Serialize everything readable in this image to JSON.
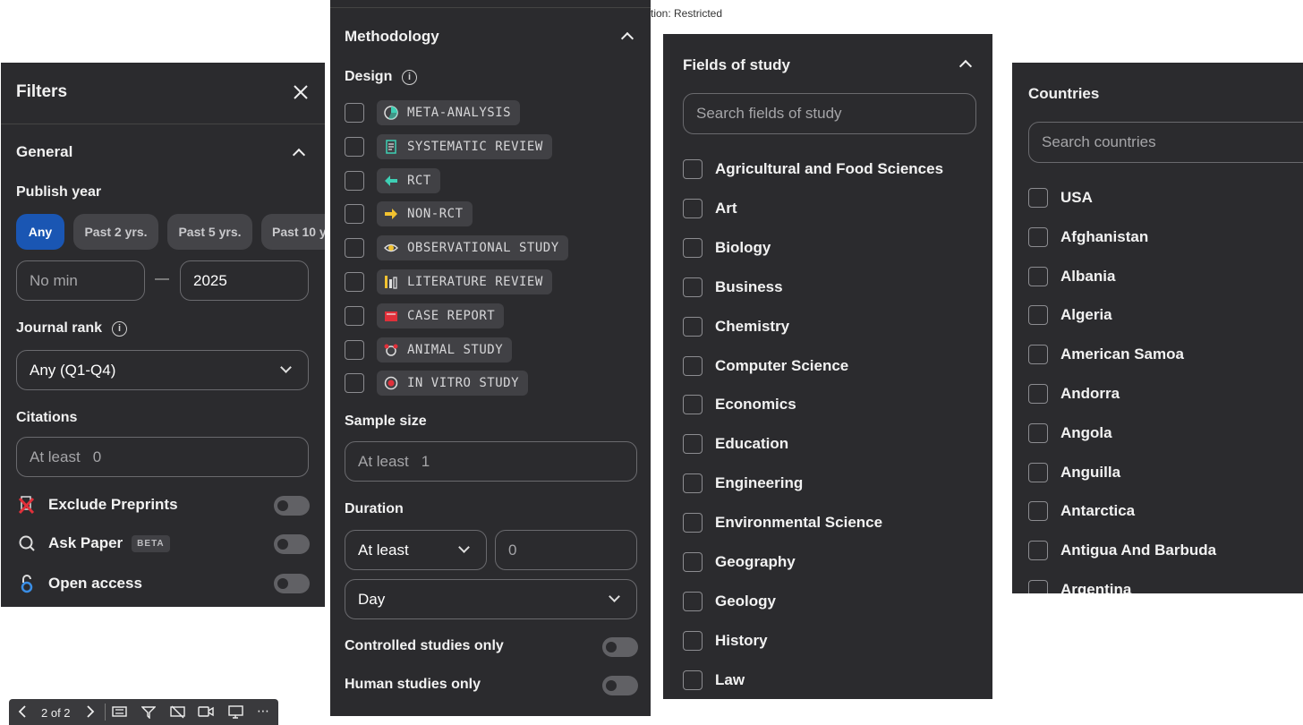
{
  "top_caption": "tion: Restricted",
  "filters": {
    "title": "Filters",
    "general": {
      "heading": "General",
      "publish_year_label": "Publish year",
      "year_options": [
        "Any",
        "Past 2 yrs.",
        "Past 5 yrs.",
        "Past 10 y"
      ],
      "min_placeholder": "No min",
      "dash": "—",
      "max_value": "2025",
      "journal_rank_label": "Journal rank",
      "journal_rank_value": "Any (Q1-Q4)",
      "citations_label": "Citations",
      "citations_prefix": "At least",
      "citations_value": "0",
      "toggles": [
        {
          "label": "Exclude Preprints",
          "icon": "preprint-icon"
        },
        {
          "label": "Ask Paper",
          "badge": "BETA",
          "icon": "ask-paper-icon"
        },
        {
          "label": "Open access",
          "icon": "open-lock-icon"
        }
      ]
    }
  },
  "methodology": {
    "heading": "Methodology",
    "design_label": "Design",
    "designs": [
      {
        "label": "META-ANALYSIS",
        "icon": "pie-icon",
        "color": "#3ecfb4"
      },
      {
        "label": "SYSTEMATIC REVIEW",
        "icon": "clipboard-icon",
        "color": "#3ecfb4"
      },
      {
        "label": "RCT",
        "icon": "arrow-back-icon",
        "color": "#3ecfb4"
      },
      {
        "label": "NON-RCT",
        "icon": "forward-icon",
        "color": "#f2c230"
      },
      {
        "label": "OBSERVATIONAL STUDY",
        "icon": "eye-icon",
        "color": "#f2c230"
      },
      {
        "label": "LITERATURE REVIEW",
        "icon": "books-icon",
        "color": "#f2c230"
      },
      {
        "label": "CASE REPORT",
        "icon": "folder-icon",
        "color": "#e0303a"
      },
      {
        "label": "ANIMAL STUDY",
        "icon": "animal-icon",
        "color": "#e0303a"
      },
      {
        "label": "IN VITRO STUDY",
        "icon": "petri-icon",
        "color": "#e0303a"
      }
    ],
    "sample_size_label": "Sample size",
    "sample_prefix": "At least",
    "sample_value": "1",
    "duration_label": "Duration",
    "duration_mode": "At least",
    "duration_value": "0",
    "duration_unit": "Day",
    "controlled_label": "Controlled studies only",
    "human_label": "Human studies only"
  },
  "fields": {
    "heading": "Fields of study",
    "search_placeholder": "Search fields of study",
    "items": [
      "Agricultural and Food Sciences",
      "Art",
      "Biology",
      "Business",
      "Chemistry",
      "Computer Science",
      "Economics",
      "Education",
      "Engineering",
      "Environmental Science",
      "Geography",
      "Geology",
      "History",
      "Law"
    ]
  },
  "countries": {
    "heading": "Countries",
    "search_placeholder": "Search countries",
    "items": [
      "USA",
      "Afghanistan",
      "Albania",
      "Algeria",
      "American Samoa",
      "Andorra",
      "Angola",
      "Anguilla",
      "Antarctica",
      "Antigua And Barbuda",
      "Argentina"
    ]
  },
  "viewer": {
    "page_indicator": "2 of 2"
  }
}
